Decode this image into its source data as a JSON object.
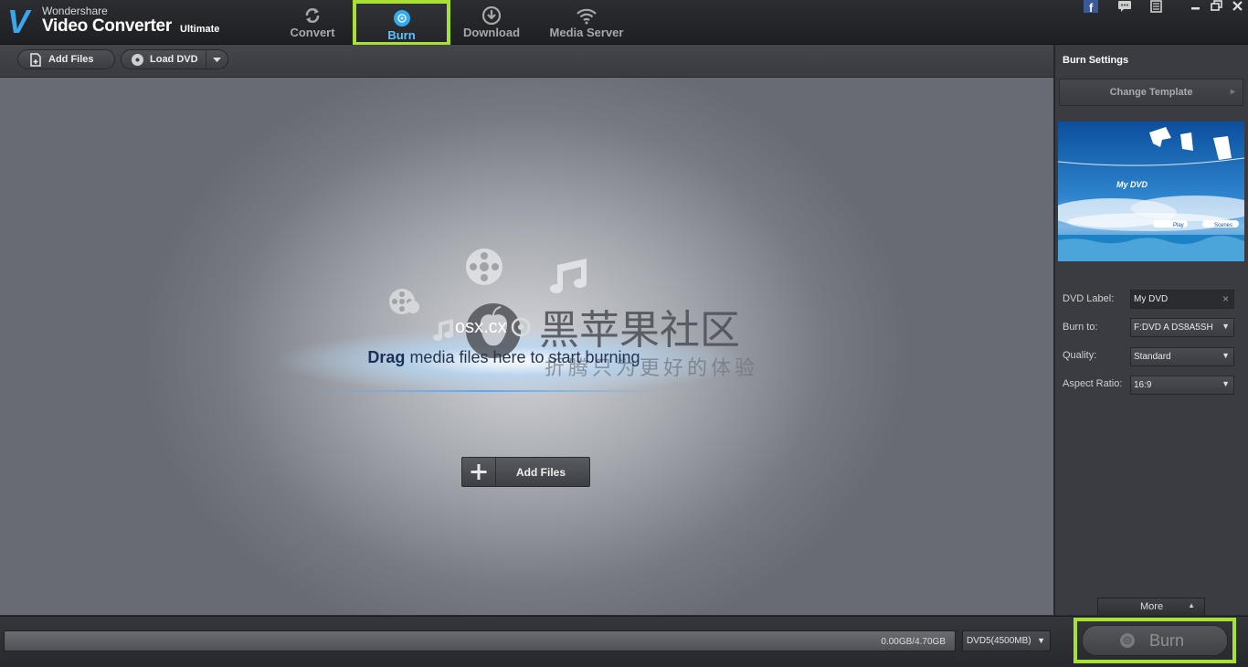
{
  "app": {
    "brand": "Wondershare",
    "product": "Video Converter",
    "edition": "Ultimate"
  },
  "tabs": [
    {
      "label": "Convert",
      "icon": "convert-icon"
    },
    {
      "label": "Burn",
      "icon": "burn-disc-icon",
      "active": true
    },
    {
      "label": "Download",
      "icon": "download-icon"
    },
    {
      "label": "Media Server",
      "icon": "wifi-icon"
    }
  ],
  "window_controls": [
    "facebook-icon",
    "feedback-icon",
    "menu-icon",
    "minimize-icon",
    "restore-icon",
    "close-icon"
  ],
  "toolbar": {
    "add_files": "Add Files",
    "load_dvd": "Load DVD"
  },
  "dropzone": {
    "drag_bold": "Drag",
    "drag_rest": " media files here to start burning",
    "add_files": "Add Files",
    "watermark": {
      "site": "osx.cx",
      "cn_title": "黑苹果社区",
      "cn_sub": "折腾只为更好的体验"
    }
  },
  "burn_settings": {
    "title": "Burn Settings",
    "change_template": "Change Template",
    "template_preview": {
      "title": "My DVD",
      "play": "Play",
      "scenes": "Scenes"
    },
    "dvd_label": {
      "label": "DVD Label:",
      "value": "My DVD"
    },
    "burn_to": {
      "label": "Burn to:",
      "value": "F:DVD A  DS8A5SH"
    },
    "quality": {
      "label": "Quality:",
      "value": "Standard"
    },
    "aspect_ratio": {
      "label": "Aspect Ratio:",
      "value": "16:9"
    },
    "more": "More"
  },
  "bottom": {
    "capacity": "0.00GB/4.70GB",
    "disc_type": "DVD5(4500MB)",
    "burn": "Burn",
    "progress_fraction": 0.0
  },
  "colors": {
    "accent_blue": "#3aa7ec",
    "highlight_green": "#a8e033"
  }
}
